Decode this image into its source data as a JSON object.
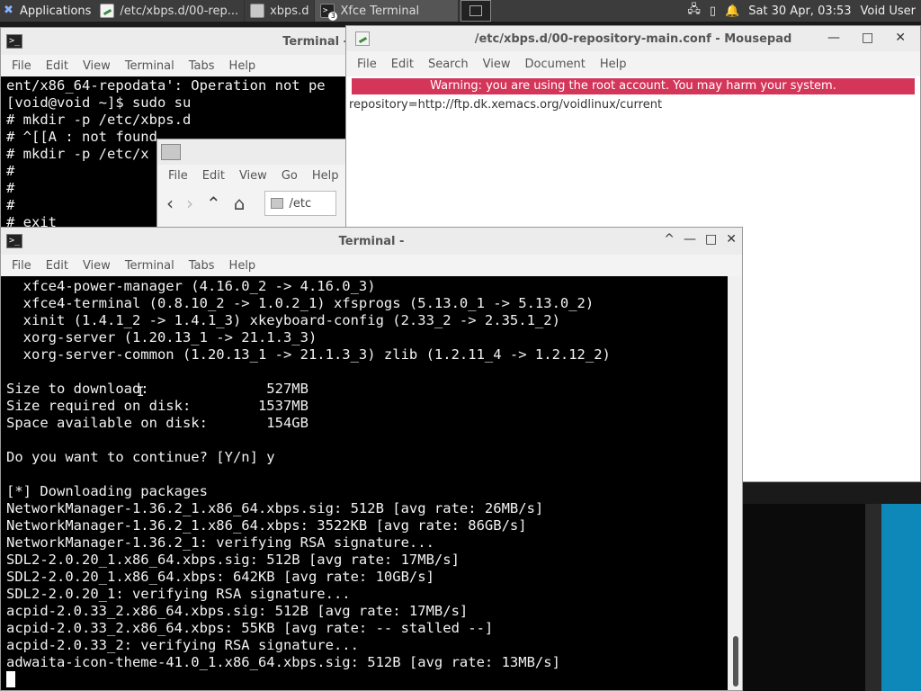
{
  "panel": {
    "apps_label": "Applications",
    "tasks": [
      {
        "label": "/etc/xbps.d/00-rep...",
        "icon": "mousepad-icon"
      },
      {
        "label": "xbps.d",
        "icon": "folder-icon"
      },
      {
        "label": "Xfce Terminal",
        "icon": "terminal-icon",
        "badge": "3"
      }
    ],
    "clock": "Sat 30 Apr, 03:53",
    "user": "Void User"
  },
  "terminal_back": {
    "title": "Terminal -",
    "menu": [
      "File",
      "Edit",
      "View",
      "Terminal",
      "Tabs",
      "Help"
    ],
    "lines": [
      "ent/x86_64-repodata': Operation not pe",
      "[void@void ~]$ sudo su",
      "# mkdir -p /etc/xbps.d",
      "# ^[[A : not found",
      "# mkdir -p /etc/x",
      "#",
      "#",
      "#",
      "# exit"
    ]
  },
  "file_manager": {
    "menu": [
      "File",
      "Edit",
      "View",
      "Go",
      "Help"
    ],
    "path": "/etc"
  },
  "mousepad": {
    "title": "/etc/xbps.d/00-repository-main.conf - Mousepad",
    "menu": [
      "File",
      "Edit",
      "Search",
      "View",
      "Document",
      "Help"
    ],
    "warning": "Warning: you are using the root account. You may harm your system.",
    "content": "repository=http://ftp.dk.xemacs.org/voidlinux/current"
  },
  "terminal_front": {
    "title": "Terminal -",
    "menu": [
      "File",
      "Edit",
      "View",
      "Terminal",
      "Tabs",
      "Help"
    ],
    "lines": [
      "  xfce4-power-manager (4.16.0_2 -> 4.16.0_3)",
      "  xfce4-terminal (0.8.10_2 -> 1.0.2_1) xfsprogs (5.13.0_1 -> 5.13.0_2)",
      "  xinit (1.4.1_2 -> 1.4.1_3) xkeyboard-config (2.33_2 -> 2.35.1_2)",
      "  xorg-server (1.20.13_1 -> 21.1.3_3)",
      "  xorg-server-common (1.20.13_1 -> 21.1.3_3) zlib (1.2.11_4 -> 1.2.12_2)",
      "",
      "Size to download:              527MB",
      "Size required on disk:        1537MB",
      "Space available on disk:       154GB",
      "",
      "Do you want to continue? [Y/n] y",
      "",
      "[*] Downloading packages",
      "NetworkManager-1.36.2_1.x86_64.xbps.sig: 512B [avg rate: 26MB/s]",
      "NetworkManager-1.36.2_1.x86_64.xbps: 3522KB [avg rate: 86GB/s]",
      "NetworkManager-1.36.2_1: verifying RSA signature...",
      "SDL2-2.0.20_1.x86_64.xbps.sig: 512B [avg rate: 17MB/s]",
      "SDL2-2.0.20_1.x86_64.xbps: 642KB [avg rate: 10GB/s]",
      "SDL2-2.0.20_1: verifying RSA signature...",
      "acpid-2.0.33_2.x86_64.xbps.sig: 512B [avg rate: 17MB/s]",
      "acpid-2.0.33_2.x86_64.xbps: 55KB [avg rate: -- stalled --]",
      "acpid-2.0.33_2: verifying RSA signature...",
      "adwaita-icon-theme-41.0_1.x86_64.xbps.sig: 512B [avg rate: 13MB/s]"
    ]
  }
}
